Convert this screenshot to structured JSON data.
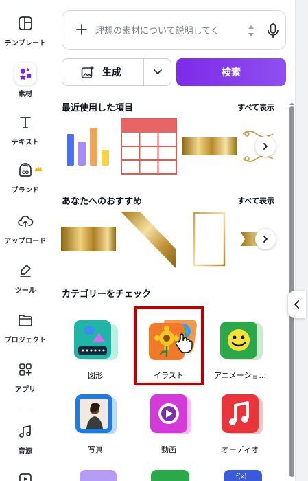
{
  "rail": {
    "items": [
      {
        "label": "テンプレート",
        "icon": "template-icon"
      },
      {
        "label": "素材",
        "icon": "elements-icon",
        "active": true
      },
      {
        "label": "テキスト",
        "icon": "text-icon"
      },
      {
        "label": "ブランド",
        "icon": "brand-icon",
        "badge": "crown-icon"
      },
      {
        "label": "アップロード",
        "icon": "upload-icon"
      },
      {
        "label": "ツール",
        "icon": "draw-tool-icon"
      },
      {
        "label": "プロジェクト",
        "icon": "folder-icon"
      },
      {
        "label": "アプリ",
        "icon": "apps-icon"
      },
      {
        "label": "音源",
        "icon": "music-icon"
      }
    ]
  },
  "search": {
    "placeholder": "理想の素材について説明してく"
  },
  "generate": {
    "label": "生成"
  },
  "search_button": {
    "label": "検索"
  },
  "recent": {
    "title": "最近使用した項目",
    "see_all": "すべて表示"
  },
  "recommended": {
    "title": "あなたへのおすすめ",
    "see_all": "すべて表示"
  },
  "categories": {
    "title": "カテゴリーをチェック",
    "items": [
      {
        "label": "図形"
      },
      {
        "label": "イラスト"
      },
      {
        "label": "アニメーショ..."
      },
      {
        "label": "写真"
      },
      {
        "label": "動画"
      },
      {
        "label": "オーディオ"
      }
    ]
  },
  "colors": {
    "accent": "#7d2ae8",
    "highlight_box": "#c00000"
  }
}
